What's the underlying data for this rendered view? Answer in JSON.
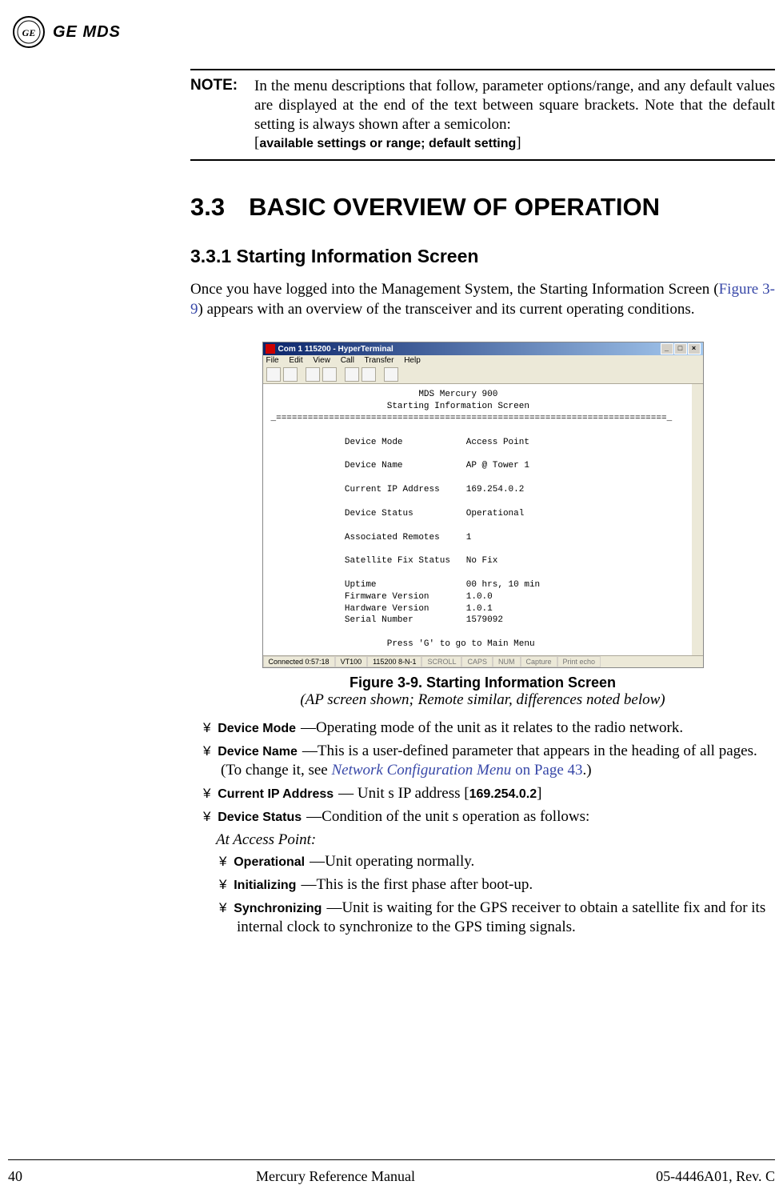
{
  "brand": "GE MDS",
  "note": {
    "label": "NOTE:",
    "body": "In the menu descriptions that follow, parameter options/range, and any default values are displayed at the end of the text between square brackets. Note that the default setting is always shown after a semicolon:",
    "settings_line": "available settings or range; default setting"
  },
  "section": {
    "number": "3.3",
    "title": "BASIC OVERVIEW OF OPERATION"
  },
  "subsection": {
    "number": "3.3.1",
    "title": "Starting Information Screen"
  },
  "intro": {
    "part1": "Once you have logged into the Management System, the Starting Information Screen (",
    "link": "Figure 3-9",
    "part2": ") appears with an overview of the transceiver and its current operating conditions."
  },
  "terminal": {
    "title": "Com 1 115200 - HyperTerminal",
    "menus": [
      "File",
      "Edit",
      "View",
      "Call",
      "Transfer",
      "Help"
    ],
    "header1": "MDS Mercury 900",
    "header2": "Starting Information Screen",
    "separator": "==========================================================================",
    "rows": [
      {
        "label": "Device Mode",
        "value": "Access Point"
      },
      {
        "label": "Device Name",
        "value": "AP @ Tower 1"
      },
      {
        "label": "Current IP Address",
        "value": "169.254.0.2"
      },
      {
        "label": "Device Status",
        "value": "Operational"
      },
      {
        "label": "Associated Remotes",
        "value": "1"
      },
      {
        "label": "Satellite Fix Status",
        "value": "No Fix"
      }
    ],
    "rows2": [
      {
        "label": "Uptime",
        "value": "00 hrs, 10 min"
      },
      {
        "label": "Firmware Version",
        "value": "1.0.0"
      },
      {
        "label": "Hardware Version",
        "value": "1.0.1"
      },
      {
        "label": "Serial Number",
        "value": "1579092"
      }
    ],
    "footer_prompt": "Press 'G' to go to Main Menu",
    "status": {
      "connected": "Connected 0:57:18",
      "emul": "VT100",
      "settings": "115200 8-N-1",
      "scroll": "SCROLL",
      "caps": "CAPS",
      "num": "NUM",
      "capture": "Capture",
      "print": "Print echo"
    }
  },
  "figure": {
    "caption": "Figure 3-9. Starting Information Screen",
    "subcaption": "(AP screen shown; Remote similar, differences noted below)"
  },
  "bullets": [
    {
      "term": "Device Mode",
      "desc_part1": "Operating mode of the unit as it relates to the radio network."
    },
    {
      "term": "Device Name",
      "desc_part1": "This is a user-defined parameter that appears in the heading of all pages. (To change it, see ",
      "link": "Network Configuration Menu",
      "desc_part2": " on Page 43",
      "desc_part3": ".)"
    },
    {
      "term": "Current IP Address",
      "desc_part1": "Unit s IP address ",
      "bracket_val": "169.254.0.2"
    },
    {
      "term": "Device Status",
      "desc_part1": "Condition of the unit s operation as follows:"
    }
  ],
  "at_heading": "At Access Point:",
  "sub_bullets": [
    {
      "term": "Operational",
      "desc": "Unit operating normally."
    },
    {
      "term": "Initializing",
      "desc": "This is the first phase after boot-up."
    },
    {
      "term": "Synchronizing",
      "desc": "Unit is waiting for the GPS receiver to obtain a satellite fix and for its internal clock to synchronize to the GPS timing signals."
    }
  ],
  "footer": {
    "page": "40",
    "title": "Mercury Reference Manual",
    "rev": "05-4446A01, Rev. C"
  }
}
